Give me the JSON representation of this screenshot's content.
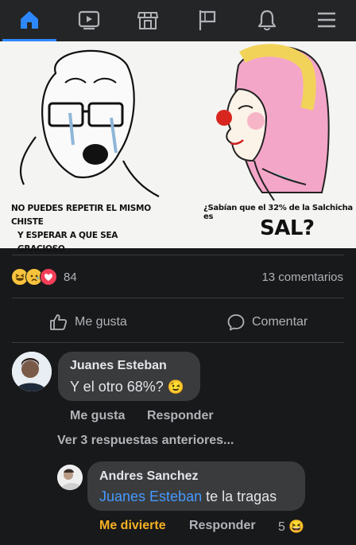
{
  "nav": {
    "items": [
      {
        "name": "home-icon",
        "active": true
      },
      {
        "name": "watch-icon",
        "active": false
      },
      {
        "name": "marketplace-icon",
        "active": false
      },
      {
        "name": "pages-flag-icon",
        "active": false
      },
      {
        "name": "notifications-bell-icon",
        "active": false
      },
      {
        "name": "menu-icon",
        "active": false
      }
    ],
    "accent": "#2d88ff"
  },
  "meme": {
    "left_caption_line1": "NO PUEDES REPETIR EL MISMO CHISTE",
    "left_caption_line2": "Y ESPERAR A QUE SEA GRACIOSO",
    "right_caption_small": "¿Sabían que el 32% de la Salchicha es",
    "right_caption_big": "SAL?"
  },
  "post_stats": {
    "reaction_icons": [
      "haha-icon",
      "sad-icon",
      "love-icon"
    ],
    "reaction_count": "84",
    "comments_count": "13 comentarios"
  },
  "actions": {
    "like_label": "Me gusta",
    "comment_label": "Comentar"
  },
  "comments": [
    {
      "author": "Juanes Esteban",
      "text": "Y el otro 68%?",
      "emoji": "😉",
      "like_label": "Me gusta",
      "reply_label": "Responder"
    }
  ],
  "view_replies": "Ver 3 respuestas anteriores...",
  "reply": {
    "author": "Andres Sanchez",
    "mention": "Juanes Esteban",
    "text": " te la tragas",
    "reaction_label": "Me divierte",
    "reply_label": "Responder",
    "reaction_count": "5",
    "reaction_emoji": "😆"
  }
}
